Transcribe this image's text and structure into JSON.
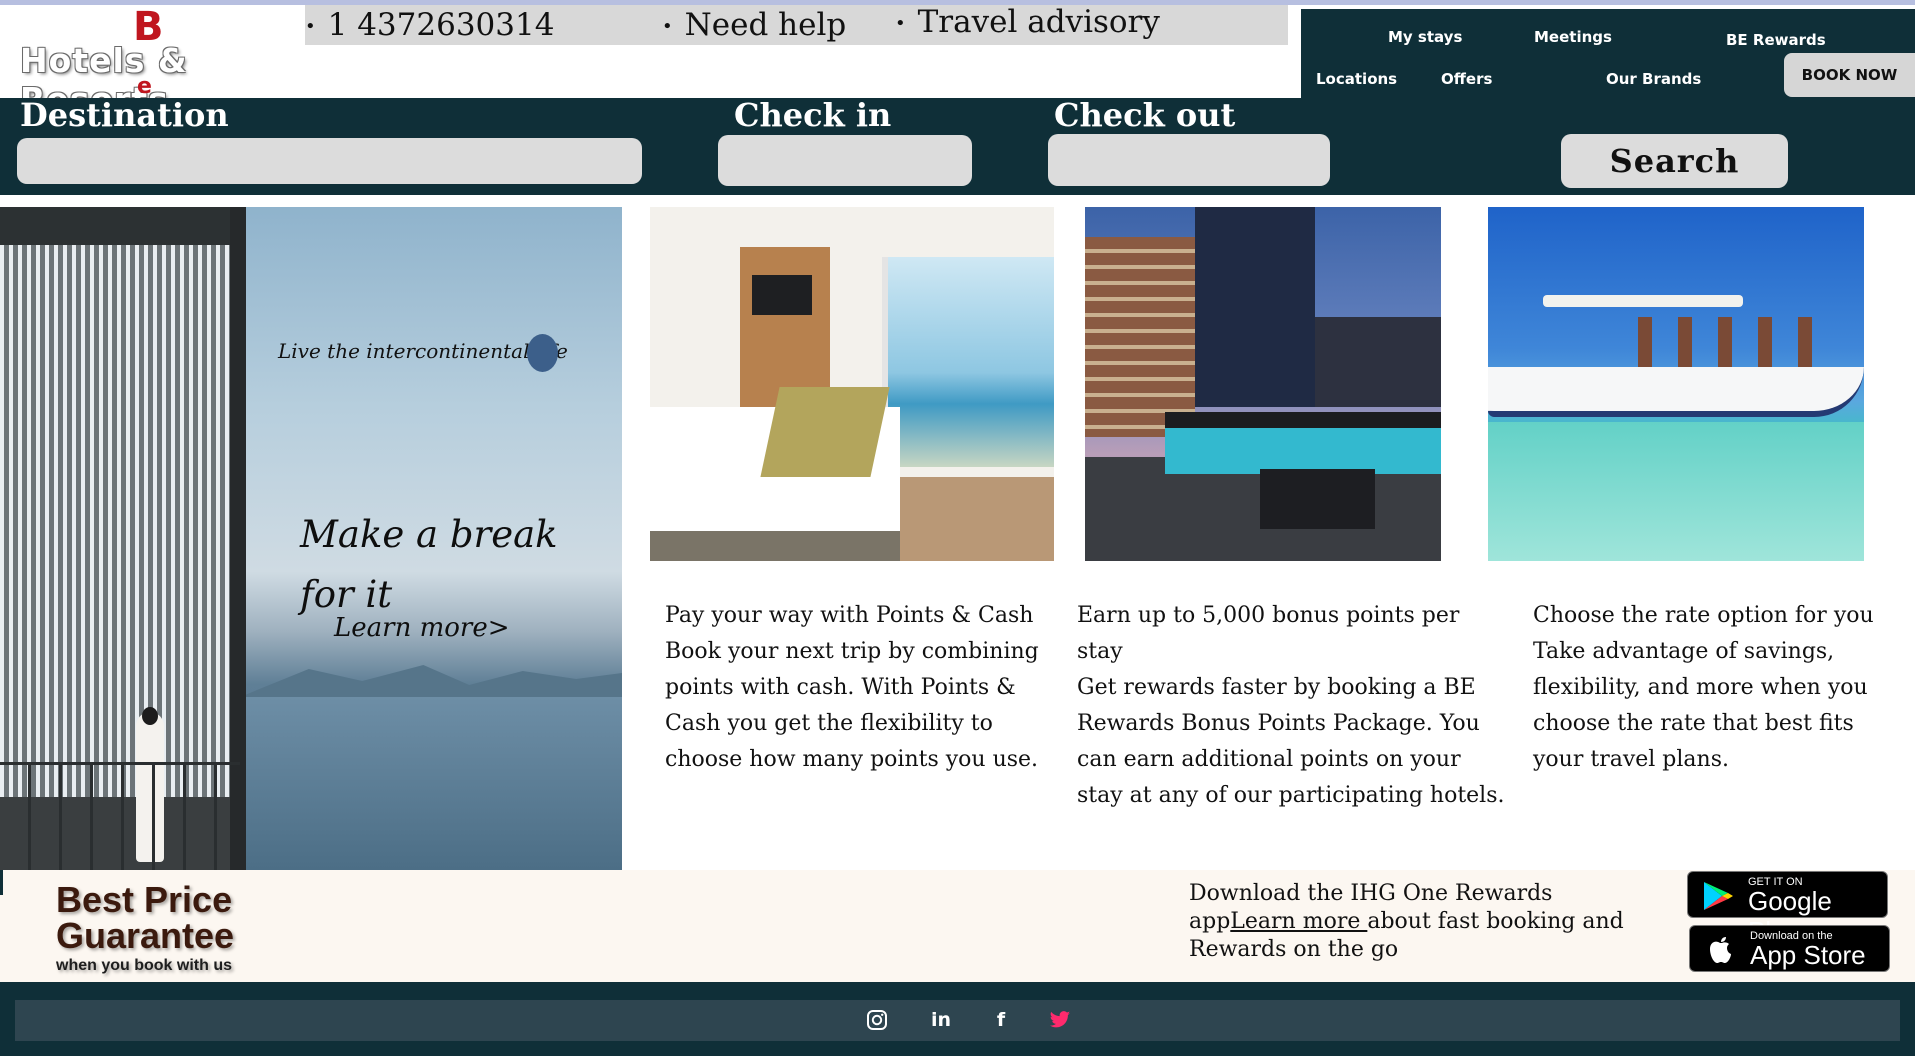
{
  "brand": {
    "logo_b": "B",
    "logo_e": "e",
    "name": "Hotels & Resorts"
  },
  "utility": {
    "phone": "1 4372630314",
    "help": "Need help",
    "advisory": "Travel advisory",
    "bullet": "•"
  },
  "nav": {
    "my_stays": "My stays",
    "meetings": "Meetings",
    "be_rewards": "BE Rewards",
    "locations": "Locations",
    "offers": "Offers",
    "our_brands": "Our Brands",
    "book_now": "BOOK NOW"
  },
  "search": {
    "destination_label": "Destination",
    "check_in_label": "Check in",
    "check_out_label": "Check out",
    "destination_value": "",
    "check_in_value": "",
    "check_out_value": "",
    "search_button": "Search"
  },
  "hero": {
    "tagline": "Live the intercontinental life",
    "headline": "Make a break for it",
    "link": "Learn more>"
  },
  "cards": [
    {
      "image": "hotel-room-image",
      "title": "Pay your way with Points & Cash",
      "body": "Book your next trip by combining points with cash. With Points & Cash you get the flexibility to choose how many points you use."
    },
    {
      "image": "rooftop-terrace-image",
      "title": "Earn up to 5,000 bonus points per stay",
      "body": "Get rewards faster by booking a BE Rewards Bonus Points Package. You can earn additional points on your stay at any of our participating hotels."
    },
    {
      "image": "boat-excursion-image",
      "title": "Choose the rate option for you",
      "body": "Take advantage of savings, flexibility, and more when you choose the rate that best fits your travel plans."
    }
  ],
  "promo": {
    "guarantee_line1": "Best Price",
    "guarantee_line2": "Guarantee",
    "guarantee_sub": "when you book with us",
    "app_text": "Download the IHG One Rewards app",
    "app_link": "Learn more ",
    "app_text_after": "about fast booking and Rewards on the go",
    "google_play_small": "GET IT ON",
    "google_play_big": "Google Play",
    "app_store_small": "Download on the",
    "app_store_big": "App Store"
  },
  "footer": {
    "social_icons": [
      "instagram-icon",
      "linkedin-icon",
      "facebook-icon",
      "twitter-icon"
    ],
    "linkedin_glyph": "in",
    "facebook_glyph": "f"
  },
  "colors": {
    "dark_teal": "#0f2f38",
    "footer_bar": "#2e4550",
    "logo_red": "#c0161f",
    "twitter_pink": "#ff2a6d",
    "promo_bg": "#fcf7f1"
  }
}
